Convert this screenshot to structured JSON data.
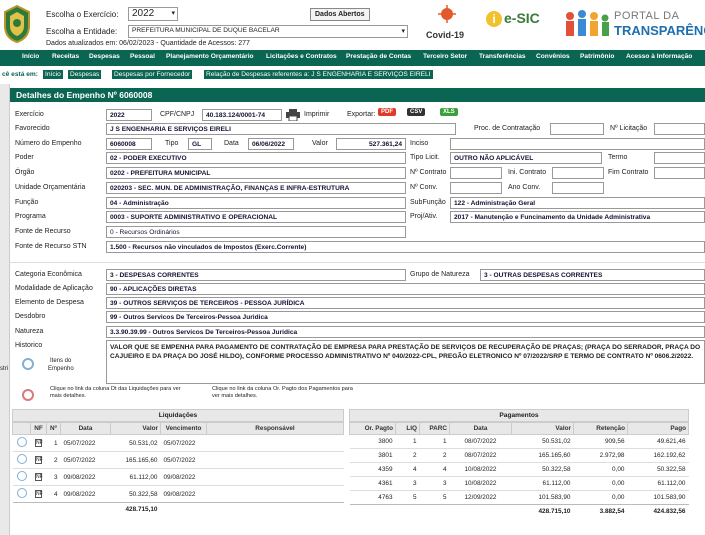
{
  "header": {
    "exercicio_label": "Escolha o Exercício:",
    "exercicio_value": "2022",
    "entidade_label": "Escolha a Entidade:",
    "entidade_value": "PREFEITURA MUNICIPAL DE DUQUE BACELAR",
    "dados_abertos": "Dados Abertos",
    "updated": "Dados atualizados em: 06/02/2023 - Quantidade de Acessos: 277",
    "covid": "Covid-19",
    "esic": "e-SIC",
    "portal_top": "PORTAL DA",
    "portal_bottom": "TRANSPARÊNC"
  },
  "nav": [
    "Início",
    "Receitas",
    "Despesas",
    "Pessoal",
    "Planejamento Orçamentário",
    "Licitações e Contratos",
    "Prestação de Contas",
    "Terceiro Setor",
    "Transferências",
    "Convênios",
    "Patrimônio",
    "Acesso à Informação"
  ],
  "breadcrumb": {
    "prefix": "cê está em:",
    "items": [
      "Início",
      "Despesas",
      "Despesas por Fornecedor",
      "Relação de Despesas referentes a: J S ENGENHARIA E SERVIÇOS EIRELI"
    ]
  },
  "panel_title": "Detalhes do Empenho Nº 6060008",
  "form": {
    "exercicio_l": "Exercício",
    "exercicio": "2022",
    "cpf_l": "CPF/CNPJ",
    "cpf": "40.183.124/0001-74",
    "imprimir": "Imprimir",
    "exportar": "Exportar:",
    "pdf": "PDF",
    "csv": "CSV",
    "xls": "XLS",
    "favorecido_l": "Favorecido",
    "favorecido": "J S ENGENHARIA E SERVIÇOS EIRELI",
    "proc_l": "Proc. de Contratação",
    "licitacao_l": "Nº Licitação",
    "numero_l": "Número do Empenho",
    "numero": "6060008",
    "tipo_l": "Tipo",
    "tipo": "GL",
    "data_l": "Data",
    "data": "06/06/2022",
    "valor_l": "Valor",
    "valor": "527.361,24",
    "inciso_l": "Inciso",
    "poder_l": "Poder",
    "poder": "02 - PODER EXECUTIVO",
    "tipolicit_l": "Tipo Licit.",
    "tipolicit": "OUTRO NÃO APLICÁVEL",
    "termo_l": "Termo",
    "orgao_l": "Órgão",
    "orgao": "0202 - PREFEITURA MUNICIPAL",
    "ncontrato_l": "Nº Contrato",
    "inicontrato_l": "Ini. Contrato",
    "fimcontrato_l": "Fim Contrato",
    "unidade_l": "Unidade Orçamentária",
    "unidade": "020203 - SEC. MUN. DE ADMINISTRAÇÃO, FINANÇAS E INFRA-ESTRUTURA",
    "nconv_l": "Nº Conv.",
    "anoconv_l": "Ano Conv.",
    "funcao_l": "Função",
    "funcao": "04 - Administração",
    "subfuncao_l": "SubFunção",
    "subfuncao": "122 - Administração Geral",
    "programa_l": "Programa",
    "programa": "0003 - SUPORTE ADMINISTRATIVO E OPERACIONAL",
    "projativ_l": "Proj/Ativ.",
    "projativ": "2017 - Manutenção e Funcinamento da Unidade Administrativa",
    "fonte_l": "Fonte de Recurso",
    "fonte": "0 - Recursos Ordinários",
    "fontestn_l": "Fonte de Recurso STN",
    "fontestn": "1.500 - Recursos não vinculados de Impostos (Exerc.Corrente)",
    "categoria_l": "Categoria Econômica",
    "categoria": "3 - DESPESAS CORRENTES",
    "grupo_l": "Grupo de Natureza",
    "grupo": "3 - OUTRAS DESPESAS CORRENTES",
    "modalidade_l": "Modalidade de Aplicação",
    "modalidade": "90 - APLICAÇÕES DIRETAS",
    "elemento_l": "Elemento de Despesa",
    "elemento": "39 - OUTROS SERVIÇOS DE TERCEIROS - PESSOA JURÍDICA",
    "desdobro_l": "Desdobro",
    "desdobro": "99 - Outros Servicos De Terceiros-Pessoa Juridica",
    "natureza_l": "Natureza",
    "natureza": "3.3.90.39.99 - Outros Servicos De Terceiros-Pessoa Juridica",
    "historico_l": "Historico",
    "historico": "VALOR QUE SE EMPENHA PARA PAGAMENTO DE CONTRATAÇÃO DE EMPRESA PARA PRESTAÇÃO DE SERVIÇOS DE RECUPERAÇÃO DE PRAÇAS; (PRAÇA DO SERRADOR, PRAÇA DO CAJUEIRO E DA PRAÇA DO JOSÉ HILDO), CONFORME PROCESSO ADMINISTRATIVO Nº 040/2022-CPL, PREGÃO ELETRONICO Nº 07/2022/SRP E TERMO DE CONTRATO Nº 0606.2/2022.",
    "itens_l1": "Itens do",
    "itens_l2": "Empenho",
    "side_l": "stri",
    "hint1": "Clique no link da coluna Dt das Liquidações para ver mais detalhes.",
    "hint2": "Clique no link da coluna Or. Pagto dos Pagamentos para ver mais detalhes."
  },
  "liquidacoes": {
    "title": "Liquidações",
    "headers": [
      "NF",
      "Nº",
      "Data",
      "Valor",
      "Vencimento",
      "Responsável"
    ],
    "rows": [
      {
        "n": "1",
        "data": "05/07/2022",
        "valor": "50.531,02",
        "venc": "05/07/2022"
      },
      {
        "n": "2",
        "data": "05/07/2022",
        "valor": "165.165,60",
        "venc": "05/07/2022"
      },
      {
        "n": "3",
        "data": "09/08/2022",
        "valor": "61.112,00",
        "venc": "09/08/2022"
      },
      {
        "n": "4",
        "data": "09/08/2022",
        "valor": "50.322,58",
        "venc": "09/08/2022"
      }
    ],
    "total": "428.715,10"
  },
  "pagamentos": {
    "title": "Pagamentos",
    "headers": [
      "Or. Pagto",
      "LIQ",
      "PARC",
      "Data",
      "Valor",
      "Retenção",
      "Pago"
    ],
    "rows": [
      {
        "or": "3800",
        "liq": "1",
        "parc": "1",
        "data": "08/07/2022",
        "valor": "50.531,02",
        "ret": "909,56",
        "pago": "49.621,46"
      },
      {
        "or": "3801",
        "liq": "2",
        "parc": "2",
        "data": "08/07/2022",
        "valor": "165.165,60",
        "ret": "2.972,98",
        "pago": "162.192,62"
      },
      {
        "or": "4359",
        "liq": "4",
        "parc": "4",
        "data": "10/08/2022",
        "valor": "50.322,58",
        "ret": "0,00",
        "pago": "50.322,58"
      },
      {
        "or": "4361",
        "liq": "3",
        "parc": "3",
        "data": "10/08/2022",
        "valor": "61.112,00",
        "ret": "0,00",
        "pago": "61.112,00"
      },
      {
        "or": "4763",
        "liq": "5",
        "parc": "5",
        "data": "12/09/2022",
        "valor": "101.583,90",
        "ret": "0,00",
        "pago": "101.583,90"
      }
    ],
    "total_valor": "428.715,10",
    "total_ret": "3.882,54",
    "total_pago": "424.832,56"
  }
}
